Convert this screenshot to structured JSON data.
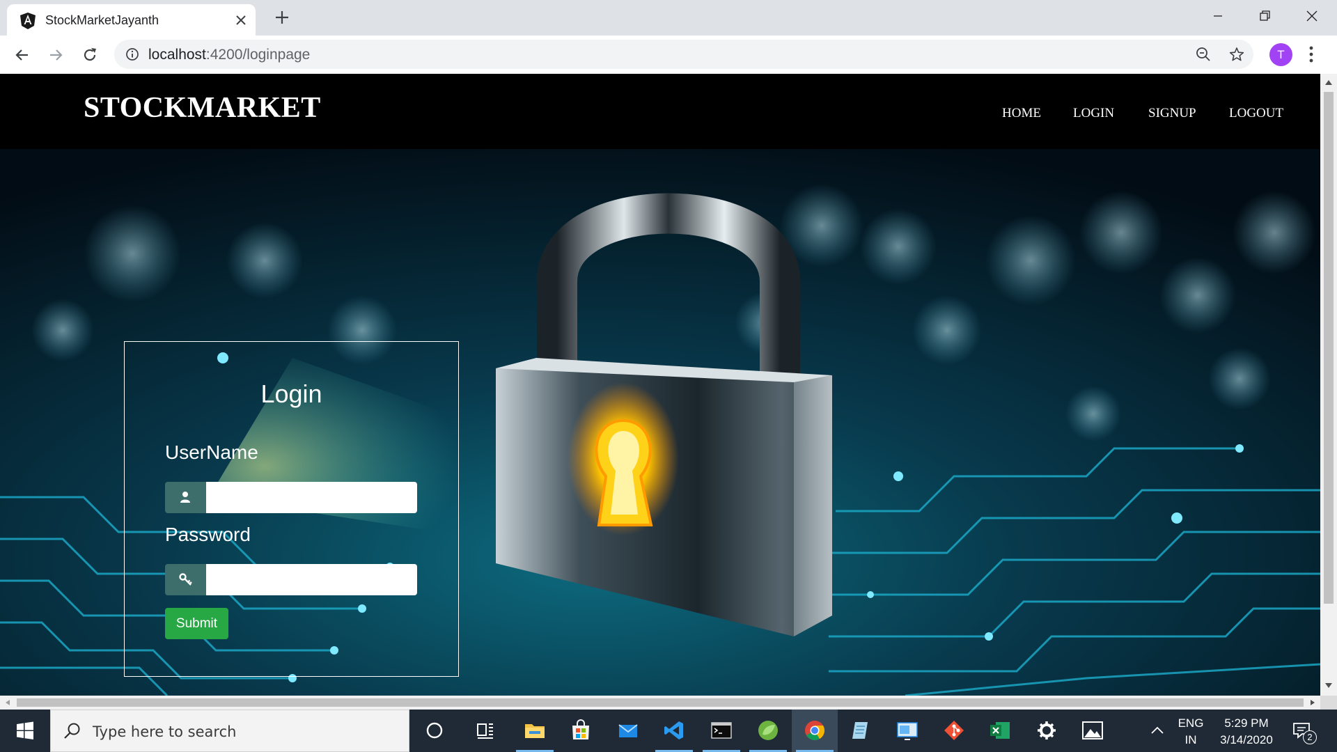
{
  "browser": {
    "tab_title": "StockMarketJayanth",
    "url_host": "localhost",
    "url_path": ":4200/loginpage",
    "avatar_letter": "T"
  },
  "navbar": {
    "brand": "STOCKMARKET",
    "links": [
      "HOME",
      "LOGIN",
      "SIGNUP",
      "LOGOUT"
    ]
  },
  "login": {
    "title": "Login",
    "username_label": "UserName",
    "username_value": "",
    "password_label": "Password",
    "password_value": "",
    "submit_label": "Submit"
  },
  "taskbar": {
    "search_placeholder": "Type here to search",
    "apps": [
      "cortana-icon",
      "task-view-icon",
      "file-explorer-icon",
      "store-icon",
      "mail-icon",
      "vscode-icon",
      "terminal-icon",
      "spring-tool-suite-icon",
      "chrome-icon",
      "notepad-icon",
      "remote-desktop-icon",
      "git-icon",
      "excel-icon",
      "settings-icon",
      "photos-icon"
    ],
    "language_top": "ENG",
    "language_bottom": "IN",
    "time": "5:29 PM",
    "date": "3/14/2020",
    "notification_count": "2"
  },
  "colors": {
    "navbar_bg": "#000000",
    "submit_bg": "#28a745",
    "addon_bg": "#3e6e6c",
    "avatar_bg": "#a142f4"
  }
}
